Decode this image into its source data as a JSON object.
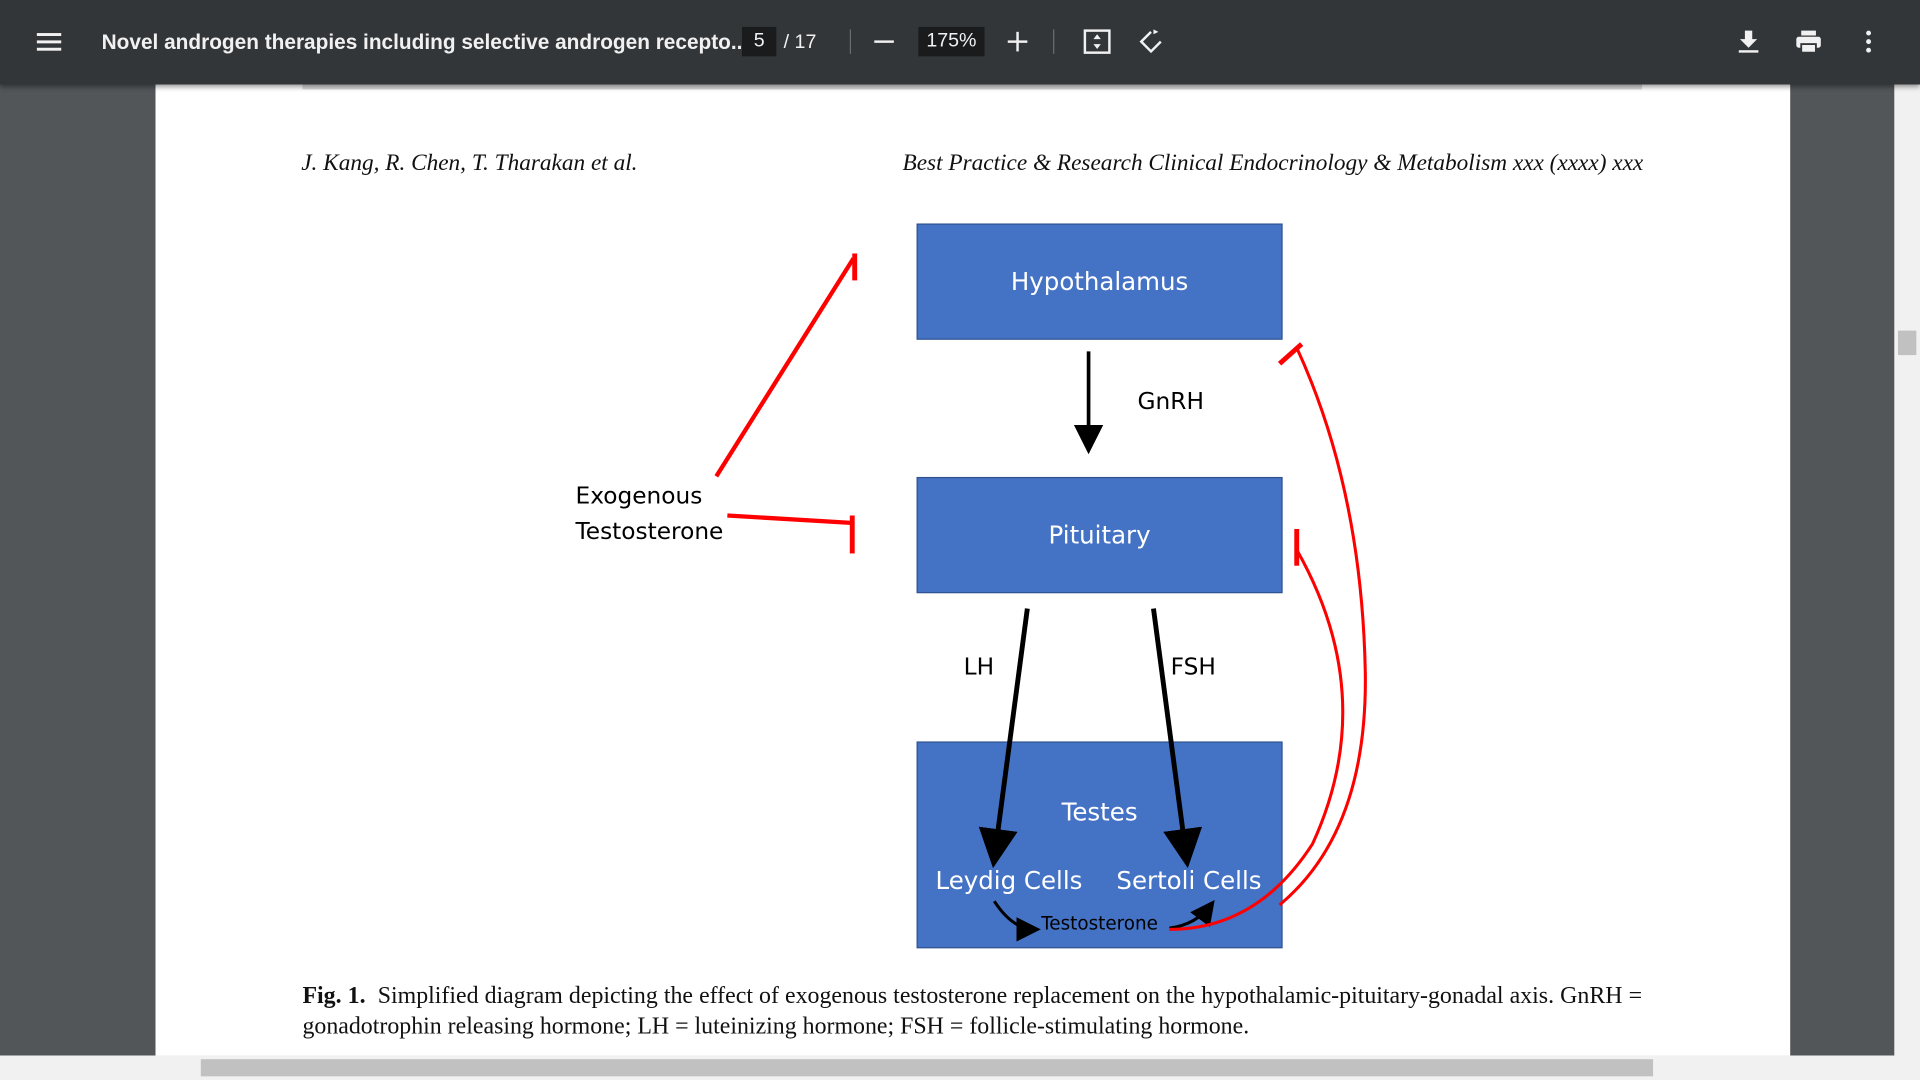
{
  "toolbar": {
    "title": "Novel androgen therapies including selective androgen recepto...",
    "page_current": "5",
    "page_total": "/ 17",
    "zoom": "175%",
    "icons": [
      "menu-icon",
      "zoom-out-icon",
      "zoom-in-icon",
      "fit-page-icon",
      "rotate-icon",
      "download-icon",
      "print-icon",
      "more-icon"
    ]
  },
  "page": {
    "header_left": "J. Kang, R. Chen, T. Tharakan et al.",
    "header_right": "Best Practice & Research Clinical Endocrinology & Metabolism xxx (xxxx) xxx",
    "figure": {
      "boxes": {
        "hypothalamus": "Hypothalamus",
        "pituitary": "Pituitary",
        "testes": "Testes",
        "leydig": "Leydig Cells",
        "sertoli": "Sertoli Cells",
        "testosterone": "Testosterone"
      },
      "labels": {
        "gnrh": "GnRH",
        "lh": "LH",
        "fsh": "FSH",
        "exo1": "Exogenous",
        "exo2": "Testosterone"
      },
      "colors": {
        "box": "#4472c4",
        "inhibit": "#ff0000",
        "arrow": "#000000"
      }
    },
    "caption_label": "Fig. 1.",
    "caption_text": "Simplified diagram depicting the effect of exogenous testosterone replacement on the hypothalamic-pituitary-gonadal axis. GnRH = gonadotrophin releasing hormone; LH = luteinizing hormone; FSH = follicle-stimulating hormone."
  }
}
